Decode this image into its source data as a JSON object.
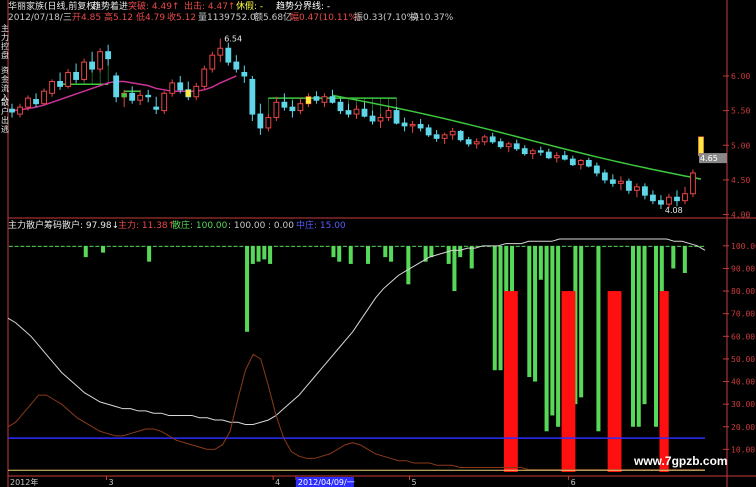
{
  "colors": {
    "up": "#e64646",
    "down": "#5fd7e8",
    "ma": "#cc3399",
    "trail": "#3ec83e",
    "hist": "#58d858",
    "red": "#ff1010",
    "white_line": "#d8d8d8",
    "brown": "#8b3a1a",
    "blue": "#2c2cff",
    "axis": "#c83c3c"
  },
  "header": {
    "line1_a": "华丽家族(日线,前复权)",
    "line1_b": "趋势着进",
    "line1_c": "突破: 4.49↑",
    "line1_d": "出击: 4.47↑",
    "line1_e": "休假: -",
    "line1_f": "趋势分界线: -",
    "line2_a": "2012/07/18/三",
    "line2_b": "开4.85",
    "line2_c": "高5.12",
    "line2_d": "低4.79",
    "line2_e": "收5.12",
    "line2_f": "量1139752.0",
    "line2_g": "额5.68亿",
    "line2_h": "幅0.47(10.11%)",
    "line2_i": "振0.33(7.10%)",
    "line2_j": "换10.37%"
  },
  "side_labels": [
    "主力控盘",
    "资金流入",
    "散户出逃"
  ],
  "indicator_header": {
    "a": "主力散户筹码",
    "b": "散户: 97.98↓",
    "c": "主力: 11.38↑",
    "d": "散庄: 100.00",
    "e": ": 100.00",
    "f": ": 0.00",
    "g": "中庄: 15.00"
  },
  "annotations": {
    "high": "6.54",
    "low": "4.08",
    "last": "4.65"
  },
  "x_ticks": [
    {
      "label": "2012年",
      "at": 0
    },
    {
      "label": "3",
      "at": 13
    },
    {
      "label": "4",
      "at": 35
    },
    {
      "label": "2012/04/09/一",
      "at": 38
    },
    {
      "label": "5",
      "at": 53
    },
    {
      "label": "6",
      "at": 74
    }
  ],
  "watermark": "www.7gpzb.com",
  "chart_data": [
    {
      "type": "candlestick",
      "y_ticks": [
        6.0,
        5.5,
        5.0,
        4.5,
        4.0
      ],
      "ylim": [
        3.95,
        6.75
      ],
      "ohlc": [
        [
          5.52,
          5.6,
          5.4,
          5.48
        ],
        [
          5.45,
          5.6,
          5.4,
          5.55
        ],
        [
          5.55,
          5.72,
          5.5,
          5.68
        ],
        [
          5.66,
          5.75,
          5.55,
          5.6
        ],
        [
          5.6,
          5.82,
          5.58,
          5.78
        ],
        [
          5.75,
          5.95,
          5.7,
          5.92
        ],
        [
          5.92,
          6.05,
          5.8,
          5.85
        ],
        [
          5.85,
          6.1,
          5.82,
          6.05
        ],
        [
          6.05,
          6.18,
          5.9,
          5.95
        ],
        [
          5.95,
          6.25,
          5.92,
          6.2
        ],
        [
          6.2,
          6.35,
          6.05,
          6.1
        ],
        [
          6.1,
          6.4,
          6.05,
          6.35
        ],
        [
          6.35,
          6.45,
          6.15,
          6.25
        ],
        [
          6.0,
          6.05,
          5.62,
          5.7
        ],
        [
          5.7,
          5.8,
          5.55,
          5.75
        ],
        [
          5.75,
          5.85,
          5.6,
          5.65
        ],
        [
          5.65,
          5.8,
          5.58,
          5.72
        ],
        [
          5.72,
          5.8,
          5.62,
          5.7
        ],
        [
          5.55,
          5.7,
          5.45,
          5.52
        ],
        [
          5.5,
          5.78,
          5.45,
          5.75
        ],
        [
          5.75,
          5.95,
          5.7,
          5.9
        ],
        [
          5.9,
          6.0,
          5.75,
          5.8
        ],
        [
          5.8,
          5.92,
          5.65,
          5.7
        ],
        [
          5.7,
          5.9,
          5.65,
          5.85
        ],
        [
          5.85,
          6.15,
          5.8,
          6.1
        ],
        [
          6.1,
          6.35,
          6.05,
          6.3
        ],
        [
          6.3,
          6.54,
          6.2,
          6.4
        ],
        [
          6.4,
          6.48,
          6.15,
          6.2
        ],
        [
          6.2,
          6.3,
          6.05,
          6.1
        ],
        [
          6.05,
          6.15,
          5.9,
          6.0
        ],
        [
          5.95,
          6.0,
          5.35,
          5.45
        ],
        [
          5.45,
          5.6,
          5.15,
          5.25
        ],
        [
          5.25,
          5.45,
          5.2,
          5.4
        ],
        [
          5.4,
          5.7,
          5.35,
          5.62
        ],
        [
          5.62,
          5.75,
          5.5,
          5.55
        ],
        [
          5.55,
          5.65,
          5.4,
          5.5
        ],
        [
          5.5,
          5.68,
          5.45,
          5.6
        ],
        [
          5.6,
          5.75,
          5.55,
          5.7
        ],
        [
          5.7,
          5.78,
          5.6,
          5.65
        ],
        [
          5.62,
          5.75,
          5.55,
          5.7
        ],
        [
          5.7,
          5.8,
          5.6,
          5.62
        ],
        [
          5.62,
          5.68,
          5.45,
          5.5
        ],
        [
          5.5,
          5.6,
          5.4,
          5.45
        ],
        [
          5.45,
          5.58,
          5.38,
          5.52
        ],
        [
          5.52,
          5.62,
          5.4,
          5.42
        ],
        [
          5.42,
          5.5,
          5.3,
          5.35
        ],
        [
          5.35,
          5.45,
          5.25,
          5.4
        ],
        [
          5.4,
          5.55,
          5.35,
          5.5
        ],
        [
          5.5,
          5.55,
          5.3,
          5.32
        ],
        [
          5.32,
          5.4,
          5.2,
          5.28
        ],
        [
          5.28,
          5.35,
          5.18,
          5.3
        ],
        [
          5.3,
          5.38,
          5.2,
          5.25
        ],
        [
          5.25,
          5.3,
          5.12,
          5.15
        ],
        [
          5.15,
          5.22,
          5.05,
          5.1
        ],
        [
          5.1,
          5.18,
          5.02,
          5.15
        ],
        [
          5.15,
          5.25,
          5.08,
          5.2
        ],
        [
          5.2,
          5.22,
          5.05,
          5.08
        ],
        [
          5.08,
          5.12,
          4.98,
          5.02
        ],
        [
          5.02,
          5.1,
          4.95,
          5.05
        ],
        [
          5.05,
          5.15,
          5.0,
          5.12
        ],
        [
          5.12,
          5.18,
          5.02,
          5.05
        ],
        [
          5.05,
          5.1,
          4.95,
          4.98
        ],
        [
          4.98,
          5.05,
          4.9,
          5.02
        ],
        [
          5.02,
          5.08,
          4.92,
          4.95
        ],
        [
          4.95,
          5.0,
          4.85,
          4.88
        ],
        [
          4.88,
          4.95,
          4.8,
          4.92
        ],
        [
          4.92,
          4.98,
          4.85,
          4.9
        ],
        [
          4.9,
          4.95,
          4.8,
          4.82
        ],
        [
          4.82,
          4.9,
          4.75,
          4.85
        ],
        [
          4.85,
          4.92,
          4.78,
          4.8
        ],
        [
          4.8,
          4.85,
          4.7,
          4.72
        ],
        [
          4.72,
          4.8,
          4.65,
          4.78
        ],
        [
          4.78,
          4.82,
          4.68,
          4.7
        ],
        [
          4.7,
          4.75,
          4.55,
          4.6
        ],
        [
          4.6,
          4.65,
          4.45,
          4.5
        ],
        [
          4.5,
          4.58,
          4.4,
          4.45
        ],
        [
          4.45,
          4.55,
          4.35,
          4.48
        ],
        [
          4.48,
          4.52,
          4.3,
          4.35
        ],
        [
          4.35,
          4.45,
          4.25,
          4.4
        ],
        [
          4.4,
          4.45,
          4.22,
          4.28
        ],
        [
          4.28,
          4.35,
          4.15,
          4.2
        ],
        [
          4.2,
          4.28,
          4.08,
          4.15
        ],
        [
          4.15,
          4.3,
          4.1,
          4.25
        ],
        [
          4.25,
          4.35,
          4.12,
          4.2
        ],
        [
          4.2,
          4.4,
          4.15,
          4.3
        ],
        [
          4.3,
          4.65,
          4.25,
          4.6
        ],
        [
          4.85,
          5.12,
          4.79,
          5.12
        ]
      ],
      "ma": [
        5.5,
        5.51,
        5.53,
        5.55,
        5.58,
        5.62,
        5.66,
        5.7,
        5.74,
        5.78,
        5.82,
        5.86,
        5.9,
        5.92,
        5.92,
        5.9,
        5.88,
        5.86,
        5.82,
        5.8,
        5.78,
        5.78,
        5.78,
        5.78,
        5.8,
        5.84,
        5.9,
        5.95,
        6.0
      ]
    },
    {
      "type": "bar",
      "y_ticks": [
        100.0,
        90.0,
        80.0,
        70.0,
        60.0,
        50.0,
        40.0,
        30.0,
        20.0,
        10.0
      ],
      "ylim": [
        0,
        107
      ],
      "series": [
        {
          "name": "散户",
          "values": [
            100,
            100,
            100,
            100,
            100,
            100,
            100,
            100,
            100,
            100,
            100,
            100,
            100,
            95,
            100,
            100,
            97,
            100,
            100,
            100,
            100,
            100,
            100,
            100,
            93,
            100,
            100,
            100,
            100,
            100,
            100,
            100,
            100,
            100,
            100,
            100,
            100,
            100,
            100,
            100,
            100,
            62,
            92,
            93,
            94,
            92,
            100,
            100,
            100,
            100,
            100,
            100,
            100,
            100,
            100,
            100,
            95,
            93,
            100,
            92,
            100,
            100,
            92,
            100,
            100,
            95,
            93,
            100,
            100,
            83,
            100,
            100,
            93,
            95,
            100,
            100,
            92,
            80,
            95,
            100,
            90,
            100,
            100,
            100,
            45,
            45,
            42,
            40,
            100,
            100,
            42,
            40,
            85,
            18,
            25,
            20,
            100,
            100,
            30,
            33,
            100,
            100,
            18,
            100,
            100,
            100,
            100,
            100,
            20,
            20,
            30,
            100,
            20,
            23,
            100,
            90,
            100,
            88,
            100,
            100,
            100
          ]
        },
        {
          "name": "主力",
          "values": [
            80,
            80,
            80,
            80,
            82,
            82,
            83,
            84,
            82,
            80
          ]
        }
      ],
      "white_line": [
        68,
        66,
        63,
        60,
        56,
        52,
        48,
        44,
        41,
        38,
        35,
        33,
        31,
        30,
        29,
        28,
        28,
        27,
        27,
        26,
        26,
        25,
        25,
        25,
        25,
        24,
        24,
        23,
        23,
        22,
        22,
        21,
        21,
        22,
        23,
        25,
        28,
        31,
        34,
        38,
        42,
        46,
        50,
        54,
        58,
        62,
        67,
        72,
        77,
        81,
        84,
        87,
        89,
        91,
        93,
        95,
        96,
        97,
        98,
        98,
        99,
        99,
        100,
        100,
        100,
        101,
        101,
        101,
        102,
        102,
        102,
        102,
        103,
        103,
        103,
        103,
        103,
        103,
        103,
        103,
        103,
        103,
        103,
        103,
        103,
        103,
        103,
        102,
        102,
        101,
        100,
        98
      ],
      "brown_line": [
        20,
        22,
        26,
        30,
        34,
        34,
        32,
        30,
        27,
        24,
        22,
        20,
        18,
        17,
        16,
        16,
        17,
        18,
        19,
        19,
        18,
        16,
        14,
        13,
        12,
        11,
        10,
        10,
        12,
        18,
        32,
        45,
        52,
        50,
        38,
        25,
        15,
        9,
        7,
        6,
        6,
        7,
        8,
        10,
        12,
        13,
        12,
        10,
        8,
        7,
        6,
        5,
        5,
        4,
        4,
        4,
        3,
        3,
        3,
        2,
        2,
        2,
        2,
        2,
        2,
        2,
        2,
        2,
        1,
        1,
        1,
        1,
        1,
        1,
        1,
        1,
        1,
        1,
        1,
        1,
        1,
        1,
        1,
        1,
        1,
        1,
        1,
        1,
        1,
        1,
        1,
        1
      ],
      "blue_level": 15
    }
  ]
}
